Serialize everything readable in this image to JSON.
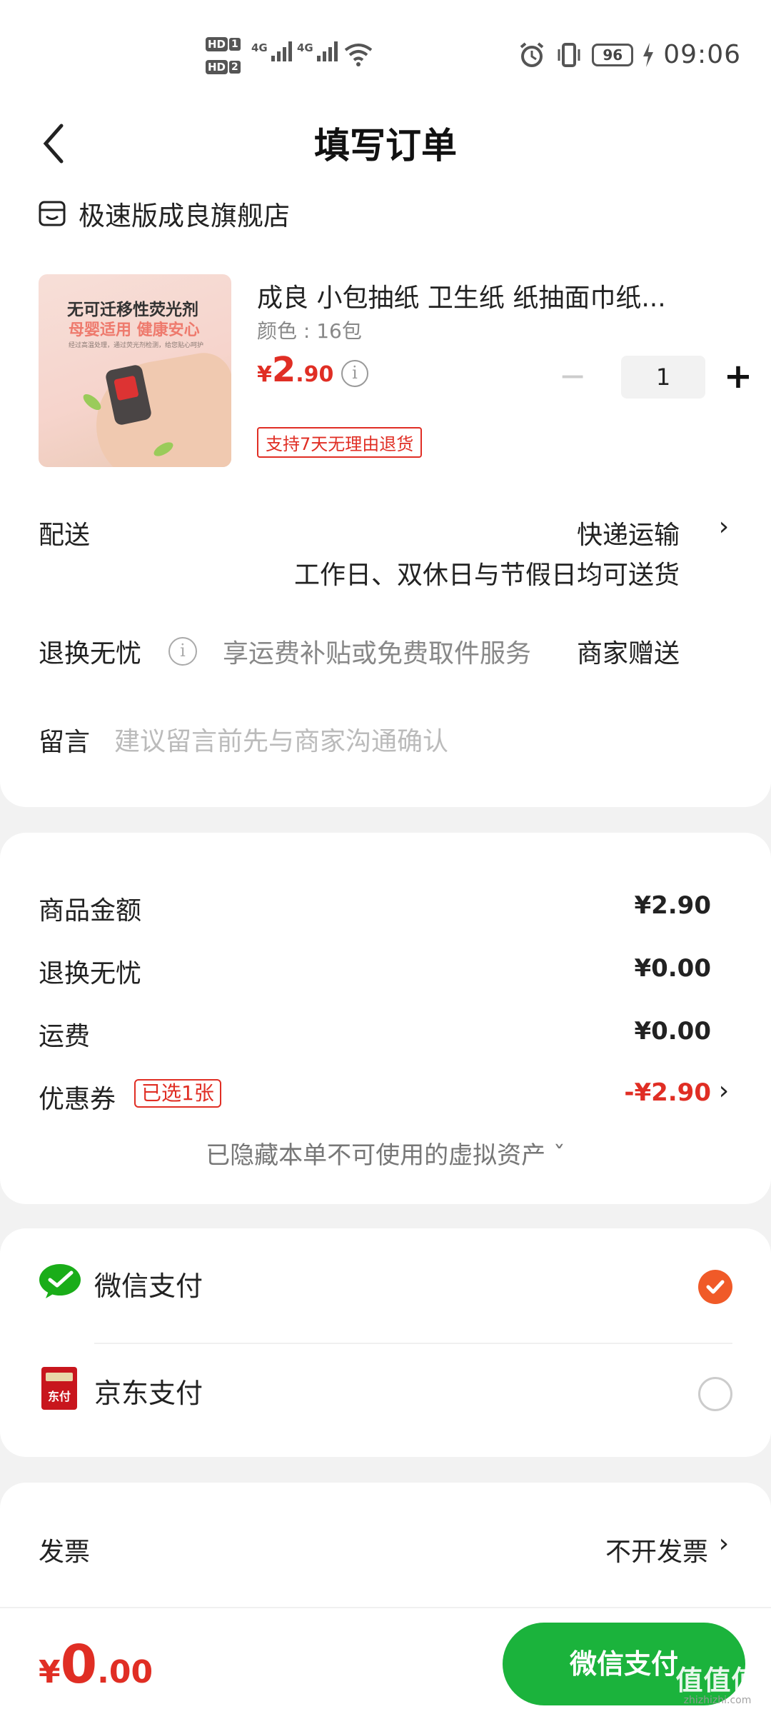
{
  "status_bar": {
    "hd1": "HD",
    "hd1_num": "1",
    "hd2": "HD",
    "hd2_num": "2",
    "net1": "4G",
    "net2": "4G",
    "battery": "96",
    "time": "09:06"
  },
  "header": {
    "title": "填写订单"
  },
  "store": {
    "name": "极速版成良旗舰店"
  },
  "product": {
    "image_text": {
      "line1": "无可迁移性荧光剂",
      "line2": "母婴适用 健康安心",
      "line3": "经过高温处理，通过荧光剂检测，给您贴心呵护"
    },
    "title": "成良 小包抽纸  卫生纸   纸抽面巾纸...",
    "spec": "颜色 : 16包",
    "price_currency": "¥",
    "price_int": "2",
    "price_dec": ".90",
    "quantity": "1",
    "return_tag": "支持7天无理由退货"
  },
  "delivery": {
    "label": "配送",
    "method": "快递运输",
    "desc": "工作日、双休日与节假日均可送货"
  },
  "worry_free": {
    "label": "退换无忧",
    "desc": "享运费补贴或免费取件服务",
    "gift": "商家赠送"
  },
  "message": {
    "label": "留言",
    "placeholder": "建议留言前先与商家沟通确认"
  },
  "amounts": {
    "goods_label": "商品金额",
    "goods_value": "¥2.90",
    "worry_label": "退换无忧",
    "worry_value": "¥0.00",
    "freight_label": "运费",
    "freight_value": "¥0.00",
    "coupon_label": "优惠券",
    "coupon_tag": "已选1张",
    "coupon_value": "-¥2.90",
    "hidden_assets": "已隐藏本单不可使用的虚拟资产 ˇ"
  },
  "payment": {
    "wechat_label": "微信支付",
    "jd_label": "京东支付",
    "jd_icon_text": "东付",
    "selected": "wechat"
  },
  "invoice": {
    "label": "发票",
    "value": "不开发票"
  },
  "footer": {
    "total_currency": "¥",
    "total_int": "0",
    "total_dec": ".00",
    "pay_button": "微信支付"
  },
  "watermark": {
    "big": "值值值",
    "small": "zhizhizhi.com"
  },
  "colors": {
    "accent_red": "#e02e24",
    "pay_green": "#1bb33c",
    "check_orange": "#f05a28"
  }
}
